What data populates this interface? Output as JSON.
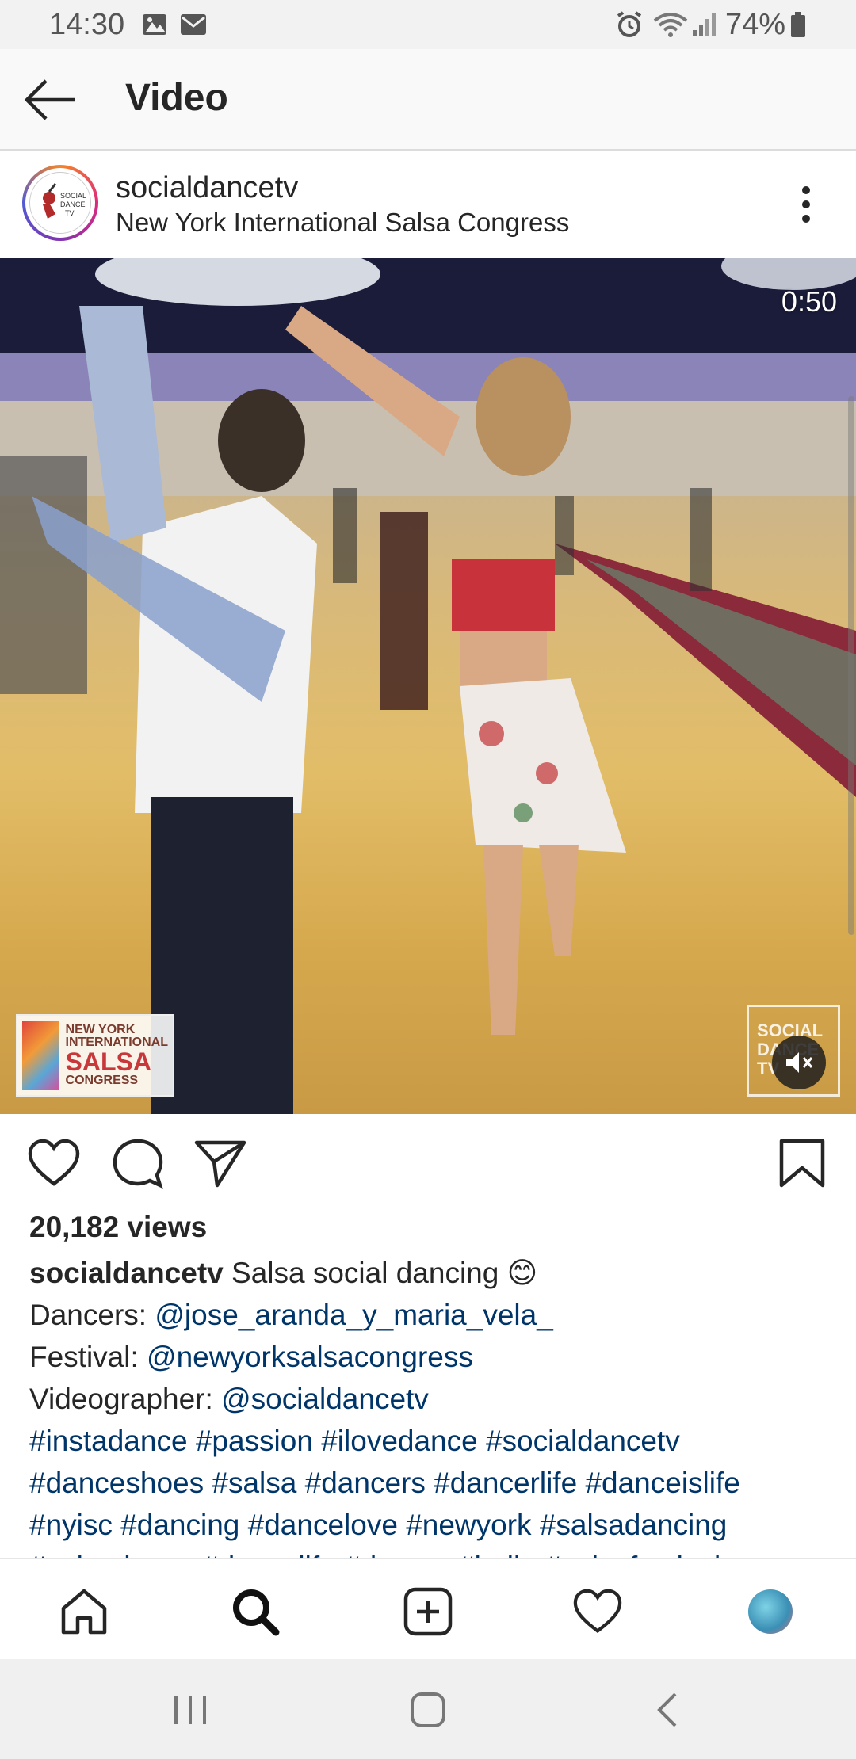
{
  "status_bar": {
    "time": "14:30",
    "battery": "74%",
    "icons": [
      "gallery-icon",
      "mail-icon",
      "alarm-icon",
      "wifi-icon",
      "signal-icon",
      "battery-icon"
    ]
  },
  "app_bar": {
    "title": "Video",
    "back_icon": "arrow-left-icon"
  },
  "post": {
    "username": "socialdancetv",
    "location": "New York International Salsa Congress",
    "avatar_logo_text": "SOCIAL DANCE TV",
    "more_icon": "more-vertical-icon"
  },
  "video": {
    "timer": "0:50",
    "mute_icon": "volume-muted-icon",
    "watermark_left": {
      "line1": "NEW YORK",
      "line2": "INTERNATIONAL",
      "line3": "SALSA",
      "line4": "CONGRESS"
    },
    "watermark_right": {
      "line1": "SOCIAL",
      "line2": "DANCE",
      "line3": "TV"
    }
  },
  "actions": {
    "like_icon": "heart-icon",
    "comment_icon": "comment-icon",
    "share_icon": "send-icon",
    "save_icon": "bookmark-icon"
  },
  "caption": {
    "views": "20,182 views",
    "username": "socialdancetv",
    "text": " Salsa social dancing 😊",
    "dancers_label": "Dancers: ",
    "dancers_link": "@jose_aranda_y_maria_vela_",
    "festival_label": "Festival: ",
    "festival_link": "@newyorksalsacongress",
    "videographer_label": "Videographer: ",
    "videographer_link": "@socialdancetv",
    "hashtags_line1": [
      "#instadance",
      "#passion",
      "#ilovedance",
      "#socialdancetv"
    ],
    "hashtags_line2": [
      "#danceshoes",
      "#salsa",
      "#dancers",
      "#dancerlife",
      "#danceislife"
    ],
    "hashtags_line3": [
      "#nyisc",
      "#dancing",
      "#dancelove",
      "#newyork",
      "#salsadancing"
    ],
    "hashtags_line4": [
      "#salsadance",
      "#dancelife",
      "#dancer",
      "#baile",
      "#salsafestival"
    ]
  },
  "bottom_nav": {
    "items": [
      "home-icon",
      "search-icon",
      "add-post-icon",
      "activity-heart-icon",
      "profile-avatar"
    ]
  },
  "system_nav": {
    "items": [
      "recent-apps-icon",
      "home-button-icon",
      "back-button-icon"
    ]
  },
  "colors": {
    "link": "#003569",
    "text": "#262626",
    "status_bar_bg": "#f2f2f2"
  }
}
